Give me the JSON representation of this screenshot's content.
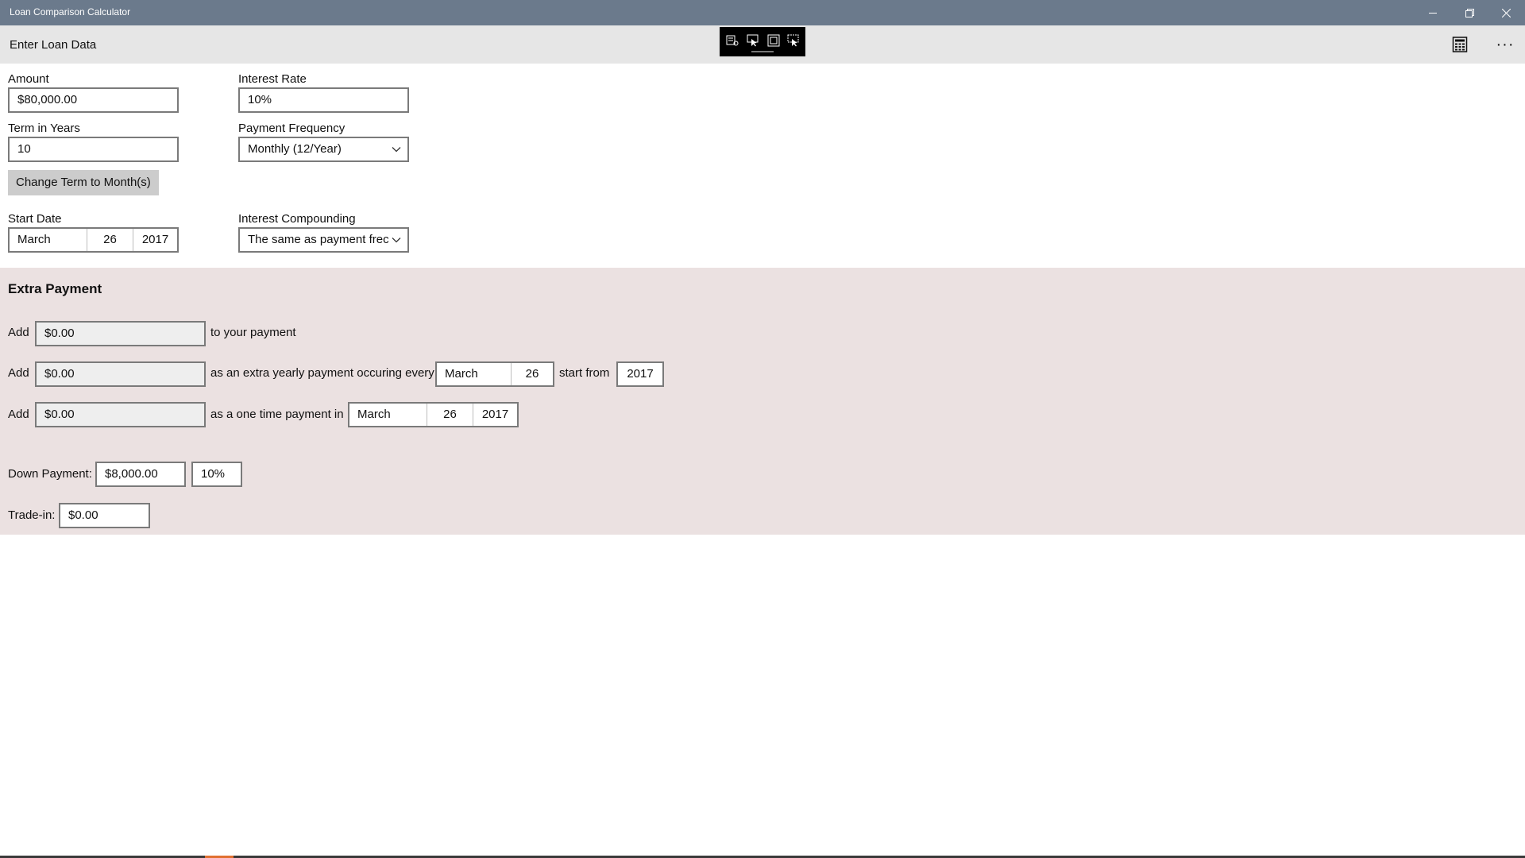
{
  "window": {
    "title": "Loan Comparison Calculator"
  },
  "header": {
    "page_title": "Enter Loan Data",
    "more_label": "···"
  },
  "form": {
    "amount_label": "Amount",
    "amount_value": "$80,000.00",
    "interest_label": "Interest Rate",
    "interest_value": "10%",
    "term_label": "Term in Years",
    "term_value": "10",
    "frequency_label": "Payment Frequency",
    "frequency_value": "Monthly (12/Year)",
    "change_term_label": "Change Term to Month(s)",
    "start_date_label": "Start Date",
    "start_date": {
      "month": "March",
      "day": "26",
      "year": "2017"
    },
    "compounding_label": "Interest Compounding",
    "compounding_value": "The same as payment frec"
  },
  "extra": {
    "title": "Extra Payment",
    "add_label": "Add",
    "row1": {
      "amount": "$0.00",
      "suffix": "to your payment"
    },
    "row2": {
      "amount": "$0.00",
      "text": "as an extra yearly payment occuring every",
      "month": "March",
      "day": "26",
      "start_text": "start from",
      "year": "2017"
    },
    "row3": {
      "amount": "$0.00",
      "text": "as a one time payment in",
      "month": "March",
      "day": "26",
      "year": "2017"
    },
    "down_payment_label": "Down Payment:",
    "down_payment_value": "$8,000.00",
    "down_payment_percent": "10%",
    "trade_in_label": "Trade-in:",
    "trade_in_value": "$0.00"
  },
  "colors": {
    "titlebar": "#6b7a8c",
    "command_bar": "#e6e6e6",
    "extra_section": "#ebe1e1",
    "button": "#cccccc"
  },
  "icons": [
    "minimize-icon",
    "restore-icon",
    "close-icon",
    "calculator-icon",
    "more-icon",
    "chevron-down-icon"
  ]
}
